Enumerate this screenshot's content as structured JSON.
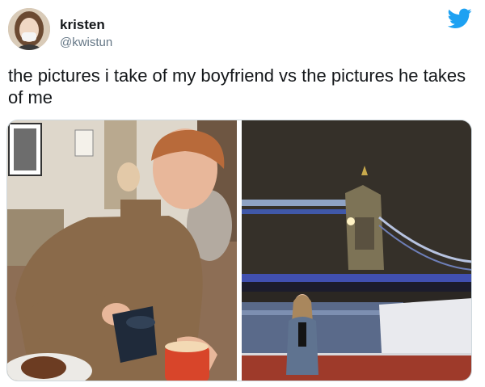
{
  "tweet": {
    "author_name": "kristen",
    "author_handle": "@kwistun",
    "text": "the pictures i take of my boyfriend vs the pictures he takes of me"
  },
  "icons": {
    "avatar": "user-avatar",
    "brand": "twitter-bird-icon"
  },
  "colors": {
    "twitter_blue": "#1da1f2",
    "handle_gray": "#657786",
    "text": "#14171a"
  }
}
